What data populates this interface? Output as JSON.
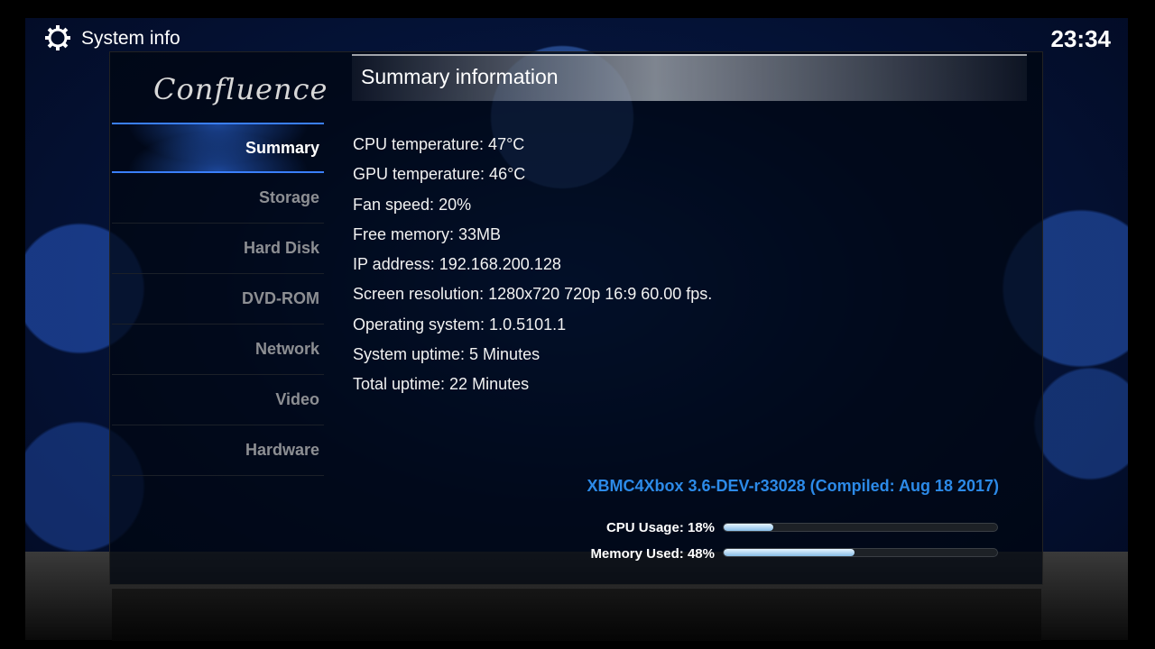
{
  "window": {
    "title": "System info",
    "clock": "23:34",
    "icon": "gear-icon"
  },
  "logo": {
    "text": "Confluence"
  },
  "sidebar": {
    "items": [
      {
        "label": "Summary",
        "active": true
      },
      {
        "label": "Storage",
        "active": false
      },
      {
        "label": "Hard Disk",
        "active": false
      },
      {
        "label": "DVD-ROM",
        "active": false
      },
      {
        "label": "Network",
        "active": false
      },
      {
        "label": "Video",
        "active": false
      },
      {
        "label": "Hardware",
        "active": false
      }
    ]
  },
  "main": {
    "title": "Summary information",
    "lines": [
      "CPU temperature: 47°C",
      "GPU temperature: 46°C",
      "Fan speed: 20%",
      "Free memory: 33MB",
      "IP address: 192.168.200.128",
      "Screen resolution: 1280x720 720p 16:9 60.00 fps.",
      "Operating system: 1.0.5101.1",
      "System uptime: 5 Minutes",
      "Total uptime: 22 Minutes"
    ],
    "version": "XBMC4Xbox 3.6-DEV-r33028 (Compiled: Aug 18 2017)",
    "cpu_usage": {
      "label": "CPU Usage: 18%",
      "value": 0.18
    },
    "memory_used": {
      "label": "Memory Used: 48%",
      "value": 0.48
    }
  },
  "colors": {
    "accent": "#2c8ae8",
    "menu_inactive": "#8d8f93",
    "active_glow": "#3a7fff"
  }
}
